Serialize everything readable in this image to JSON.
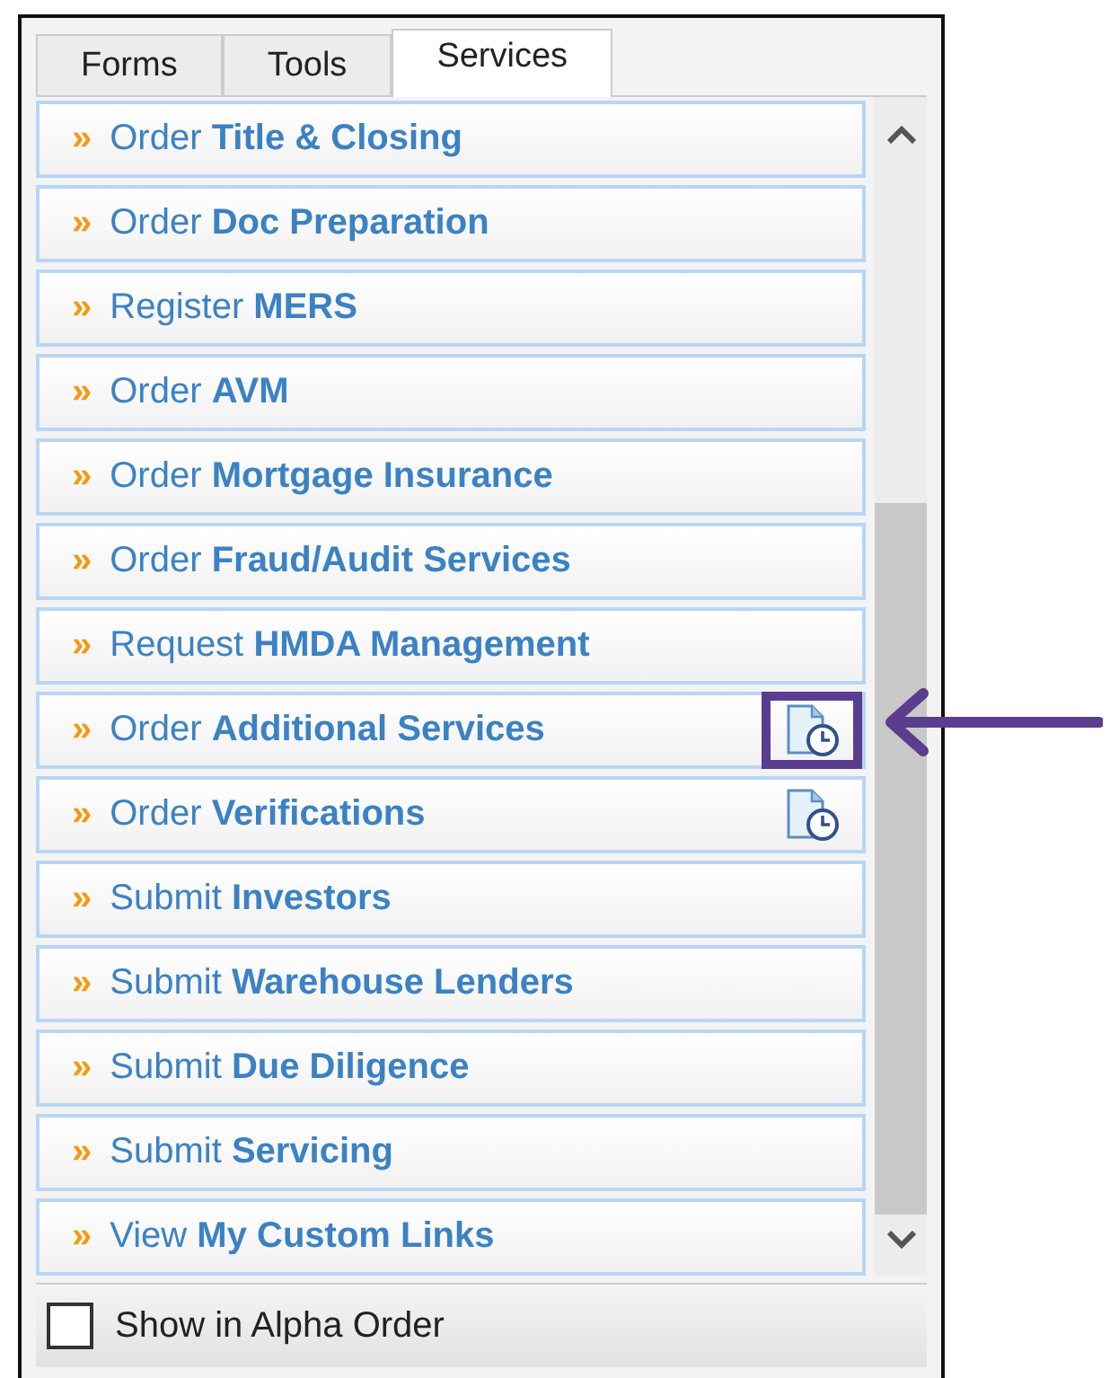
{
  "tabs": [
    {
      "label": "Forms",
      "selected": false
    },
    {
      "label": "Tools",
      "selected": false
    },
    {
      "label": "Services",
      "selected": true
    }
  ],
  "items": [
    {
      "label": "Order **Title & Closing**",
      "schedule_icon": false,
      "highlighted": false
    },
    {
      "label": "Order **Doc Preparation**",
      "schedule_icon": false,
      "highlighted": false
    },
    {
      "label": "Register **MERS**",
      "schedule_icon": false,
      "highlighted": false
    },
    {
      "label": "Order **AVM**",
      "schedule_icon": false,
      "highlighted": false
    },
    {
      "label": "Order **Mortgage Insurance**",
      "schedule_icon": false,
      "highlighted": false
    },
    {
      "label": "Order **Fraud/Audit Services**",
      "schedule_icon": false,
      "highlighted": false
    },
    {
      "label": "Request **HMDA Management**",
      "schedule_icon": false,
      "highlighted": false
    },
    {
      "label": "Order **Additional Services**",
      "schedule_icon": true,
      "highlighted": true
    },
    {
      "label": "Order **Verifications**",
      "schedule_icon": true,
      "highlighted": false
    },
    {
      "label": "Submit **Investors**",
      "schedule_icon": false,
      "highlighted": false
    },
    {
      "label": "Submit **Warehouse Lenders**",
      "schedule_icon": false,
      "highlighted": false
    },
    {
      "label": "Submit **Due Diligence**",
      "schedule_icon": false,
      "highlighted": false
    },
    {
      "label": "Submit **Servicing**",
      "schedule_icon": false,
      "highlighted": false
    },
    {
      "label": "View **My Custom Links**",
      "schedule_icon": false,
      "highlighted": false
    }
  ],
  "bullet": "»",
  "alpha_order": {
    "label": "Show in Alpha Order",
    "checked": false
  }
}
